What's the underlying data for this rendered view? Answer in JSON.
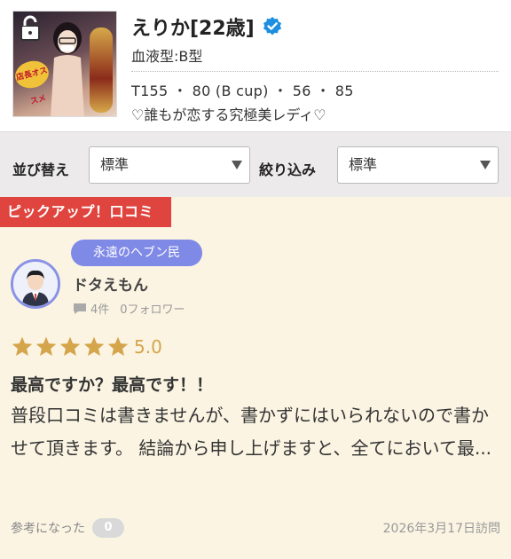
{
  "profile": {
    "name": "えりか[22歳]",
    "blood_type": "血液型:B型",
    "measurements": "T155 ・ 80 (B cup) ・ 56 ・ 85",
    "catchphrase": "♡誰もが恋する究極美レディ♡",
    "thumb_badge": "店長オススメ"
  },
  "filters": {
    "sort_label": "並び替え",
    "sort_value": "標準",
    "filter_label": "絞り込み",
    "filter_value": "標準"
  },
  "pickup_tag": "ピックアップ！口コミ",
  "review": {
    "rank_badge": "永遠のヘブン民",
    "reviewer_name": "ドタえもん",
    "post_count": "4件",
    "followers": "0フォロワー",
    "rating_stars": 5,
    "rating_score": "5.0",
    "title": "最高ですか？最高です！！",
    "body": "普段口コミは書きませんが、書かずにはいられないので書かせて頂きます。 結論から申し上げますと、全てにおいて最...",
    "helpful_label": "参考になった",
    "helpful_count": "0",
    "visit_date": "2026年3月17日訪問"
  },
  "colors": {
    "pickup_red": "#e0443e",
    "rank_purple": "#7f89e6",
    "star_gold": "#d4a54a",
    "verified_blue": "#1d8fe0",
    "panel_cream": "#fbf4e3"
  }
}
